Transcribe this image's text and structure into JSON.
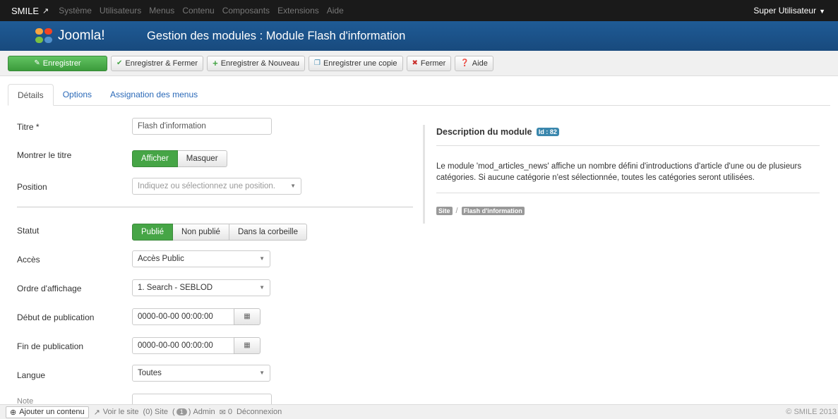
{
  "topbar": {
    "brand": "SMILE",
    "brand_icon": "external-link-icon",
    "menu": [
      "Système",
      "Utilisateurs",
      "Menus",
      "Contenu",
      "Composants",
      "Extensions",
      "Aide"
    ],
    "user": "Super Utilisateur"
  },
  "header": {
    "logo_text": "Joomla!",
    "title": "Gestion des modules : Module Flash d'information"
  },
  "toolbar": {
    "save": "Enregistrer",
    "save_close": "Enregistrer & Fermer",
    "save_new": "Enregistrer & Nouveau",
    "save_copy": "Enregistrer une copie",
    "close": "Fermer",
    "help": "Aide"
  },
  "tabs": [
    "Détails",
    "Options",
    "Assignation des menus"
  ],
  "form": {
    "title_label": "Titre *",
    "title_value": "Flash d'information",
    "show_title_label": "Montrer le titre",
    "show_title_options": [
      "Afficher",
      "Masquer"
    ],
    "position_label": "Position",
    "position_placeholder": "Indiquez ou sélectionnez une position.",
    "status_label": "Statut",
    "status_options": [
      "Publié",
      "Non publié",
      "Dans la corbeille"
    ],
    "access_label": "Accès",
    "access_value": "Accès Public",
    "order_label": "Ordre d'affichage",
    "order_value": "1. Search - SEBLOD",
    "publish_up_label": "Début de publication",
    "publish_up_value": "0000-00-00 00:00:00",
    "publish_down_label": "Fin de publication",
    "publish_down_value": "0000-00-00 00:00:00",
    "language_label": "Langue",
    "language_value": "Toutes",
    "note_label": "Note"
  },
  "description": {
    "title": "Description du module",
    "id_badge": "Id : 82",
    "text": "Le module 'mod_articles_news' affiche un nombre défini d'introductions d'article d'une ou de plusieurs catégories. Si aucune catégorie n'est sélectionnée, toutes les catégories seront utilisées.",
    "crumb_site": "Site",
    "crumb_sep": "/",
    "crumb_module": "Flash d'information"
  },
  "statusbar": {
    "add_content": "Ajouter un contenu",
    "view_site": "Voir le site",
    "site_count": "(0) Site",
    "admin_count": "1",
    "admin_label": "Admin",
    "messages": "0",
    "logout": "Déconnexion",
    "copyright": "© SMILE 2013"
  },
  "colors": {
    "header_blue": "#1f5b96",
    "success_green": "#46a546",
    "info_blue": "#3a87ad",
    "link_blue": "#2a69b8"
  }
}
